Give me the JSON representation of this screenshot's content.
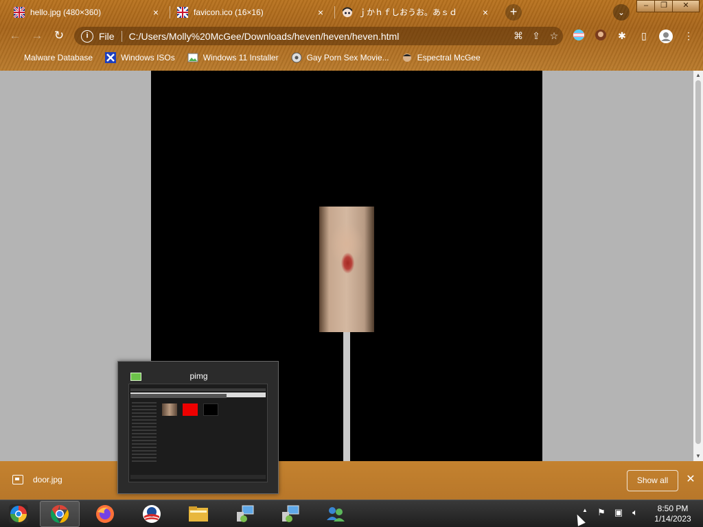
{
  "browser": {
    "tabs": [
      {
        "title": "hello.jpg (480×360)",
        "close": "×"
      },
      {
        "title": "favicon.ico (16×16)",
        "close": "×"
      },
      {
        "title": "ｊかｈｆしおうお。あｓｄ",
        "close": "×"
      }
    ],
    "new_tab": "+",
    "tab_search": "⌄",
    "window_controls": {
      "minimize": "–",
      "maximize": "❐",
      "close": "✕"
    },
    "nav": {
      "back": "←",
      "forward": "→",
      "reload": "↻"
    },
    "omnibox": {
      "info": "i",
      "scheme_label": "File",
      "url": "C:/Users/Molly%20McGee/Downloads/heven/heven/heven.html"
    },
    "bookmarks": [
      {
        "label": "Malware Database"
      },
      {
        "label": "Windows ISOs"
      },
      {
        "label": "Windows 11 Installer"
      },
      {
        "label": "Gay Porn Sex Movie..."
      },
      {
        "label": "Espectral McGee"
      }
    ]
  },
  "downloads": {
    "file": "door.jpg",
    "show_all": "Show all",
    "close": "✕"
  },
  "preview": {
    "title": "pimg"
  },
  "taskbar": {
    "time": "8:50 PM",
    "date": "1/14/2023",
    "tray_chevron": "▲"
  },
  "colors": {
    "theme_brown": "#b8721e",
    "content_bg": "#b4b4b4",
    "panel": "#000000"
  }
}
